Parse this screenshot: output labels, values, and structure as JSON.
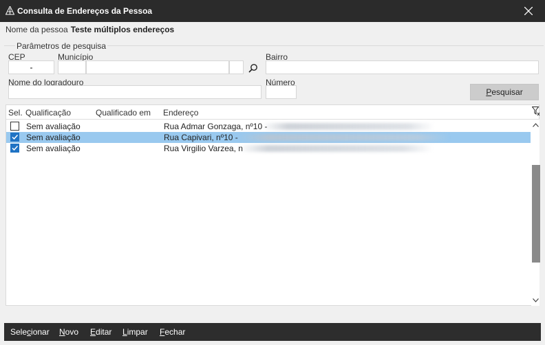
{
  "window": {
    "title": "Consulta de Endereços da Pessoa"
  },
  "person": {
    "label": "Nome da pessoa",
    "name": "Teste múltiplos endereços"
  },
  "params": {
    "legend": "Parâmetros de pesquisa",
    "cep_label": "CEP",
    "cep_value": "-",
    "municipio_label": "Município",
    "bairro_label": "Bairro",
    "logradouro_label": "Nome do logradouro",
    "numero_label": "Número",
    "search_button": {
      "pre": "",
      "accel": "P",
      "post": "esquisar"
    }
  },
  "grid": {
    "columns": [
      "Sel.",
      "Qualificação",
      "Qualificado em",
      "Endereço"
    ],
    "rows": [
      {
        "checked": false,
        "selected": false,
        "qualificacao": "Sem avaliação",
        "qualificado_em": "",
        "endereco": "Rua Admar Gonzaga, nº10 -"
      },
      {
        "checked": true,
        "selected": true,
        "qualificacao": "Sem avaliação",
        "qualificado_em": "",
        "endereco": "Rua Capivari, nº10 -"
      },
      {
        "checked": true,
        "selected": false,
        "qualificacao": "Sem avaliação",
        "qualificado_em": "",
        "endereco": "Rua Virgilio Varzea, n"
      }
    ]
  },
  "footer": {
    "selecionar": {
      "pre": "Sele",
      "accel": "c",
      "post": "ionar"
    },
    "novo": {
      "pre": "",
      "accel": "N",
      "post": "ovo"
    },
    "editar": {
      "pre": "",
      "accel": "E",
      "post": "ditar"
    },
    "limpar": {
      "pre": "",
      "accel": "L",
      "post": "impar"
    },
    "fechar": {
      "pre": "",
      "accel": "F",
      "post": "echar"
    }
  },
  "icons": {
    "app": "app-logo-icon",
    "close": "close-icon",
    "search": "search-icon",
    "filter": "filter-icon",
    "scroll_up": "chevron-up-icon",
    "scroll_down": "chevron-down-icon"
  },
  "colors": {
    "titlebar": "#2b2b2b",
    "selected_row": "#99c9ef",
    "checkbox": "#1f73c4",
    "footer": "#2d2d2d"
  }
}
